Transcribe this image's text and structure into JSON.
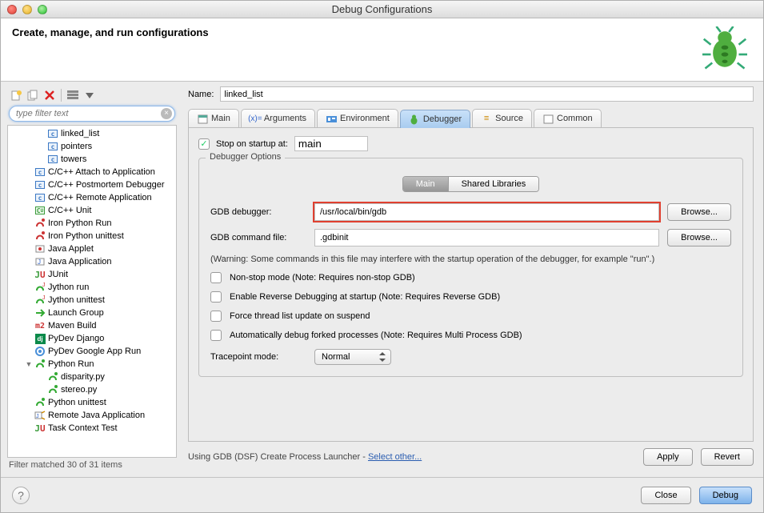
{
  "window": {
    "title": "Debug Configurations"
  },
  "header": {
    "title": "Create, manage, and run configurations"
  },
  "toolbar_icons": [
    "new",
    "duplicate",
    "delete",
    "collapse",
    "dropdown"
  ],
  "filter": {
    "placeholder": "type filter text"
  },
  "tree": [
    {
      "indent": 2,
      "icon": "c-blue",
      "label": "linked_list",
      "twist": ""
    },
    {
      "indent": 2,
      "icon": "c-blue",
      "label": "pointers",
      "twist": ""
    },
    {
      "indent": 2,
      "icon": "c-blue",
      "label": "towers",
      "twist": ""
    },
    {
      "indent": 1,
      "icon": "c-blue",
      "label": "C/C++ Attach to Application",
      "twist": ""
    },
    {
      "indent": 1,
      "icon": "c-blue",
      "label": "C/C++ Postmortem Debugger",
      "twist": ""
    },
    {
      "indent": 1,
      "icon": "c-blue",
      "label": "C/C++ Remote Application",
      "twist": ""
    },
    {
      "indent": 1,
      "icon": "cu-green",
      "label": "C/C++ Unit",
      "twist": ""
    },
    {
      "indent": 1,
      "icon": "py-red",
      "label": "Iron Python Run",
      "twist": ""
    },
    {
      "indent": 1,
      "icon": "py-red",
      "label": "Iron Python unittest",
      "twist": ""
    },
    {
      "indent": 1,
      "icon": "applet",
      "label": "Java Applet",
      "twist": ""
    },
    {
      "indent": 1,
      "icon": "java",
      "label": "Java Application",
      "twist": ""
    },
    {
      "indent": 1,
      "icon": "junit",
      "label": "JUnit",
      "twist": ""
    },
    {
      "indent": 1,
      "icon": "jy-green",
      "label": "Jython run",
      "twist": ""
    },
    {
      "indent": 1,
      "icon": "jy-green",
      "label": "Jython unittest",
      "twist": ""
    },
    {
      "indent": 1,
      "icon": "launch",
      "label": "Launch Group",
      "twist": ""
    },
    {
      "indent": 1,
      "icon": "m2",
      "label": "Maven Build",
      "twist": ""
    },
    {
      "indent": 1,
      "icon": "dj",
      "label": "PyDev Django",
      "twist": ""
    },
    {
      "indent": 1,
      "icon": "gae",
      "label": "PyDev Google App Run",
      "twist": ""
    },
    {
      "indent": 1,
      "icon": "py-green",
      "label": "Python Run",
      "twist": "▼"
    },
    {
      "indent": 2,
      "icon": "py-green",
      "label": "disparity.py",
      "twist": ""
    },
    {
      "indent": 2,
      "icon": "py-green",
      "label": "stereo.py",
      "twist": ""
    },
    {
      "indent": 1,
      "icon": "py-green",
      "label": "Python unittest",
      "twist": ""
    },
    {
      "indent": 1,
      "icon": "remote-java",
      "label": "Remote Java Application",
      "twist": ""
    },
    {
      "indent": 1,
      "icon": "task",
      "label": "Task Context Test",
      "twist": ""
    }
  ],
  "filter_status": "Filter matched 30 of 31 items",
  "name": {
    "label": "Name:",
    "value": "linked_list"
  },
  "tabs": [
    "Main",
    "Arguments",
    "Environment",
    "Debugger",
    "Source",
    "Common"
  ],
  "active_tab": "Debugger",
  "stop": {
    "label": "Stop on startup at:",
    "value": "main",
    "checked": true
  },
  "options_legend": "Debugger Options",
  "subtabs": [
    "Main",
    "Shared Libraries"
  ],
  "active_subtab": "Main",
  "form": {
    "gdb_label": "GDB debugger:",
    "gdb_value": "/usr/local/bin/gdb",
    "cmdfile_label": "GDB command file:",
    "cmdfile_value": ".gdbinit",
    "browse": "Browse...",
    "warning": "(Warning: Some commands in this file may interfere with the startup operation of the debugger, for example \"run\".)",
    "nonstop": "Non-stop mode (Note: Requires non-stop GDB)",
    "reverse": "Enable Reverse Debugging at startup (Note: Requires Reverse GDB)",
    "force": "Force thread list update on suspend",
    "autofork": "Automatically debug forked processes (Note: Requires Multi Process GDB)",
    "tracepoint_label": "Tracepoint mode:",
    "tracepoint_value": "Normal"
  },
  "launcher": {
    "prefix": "Using GDB (DSF) Create Process Launcher - ",
    "link": "Select other..."
  },
  "apply": "Apply",
  "revert": "Revert",
  "close": "Close",
  "debug": "Debug"
}
